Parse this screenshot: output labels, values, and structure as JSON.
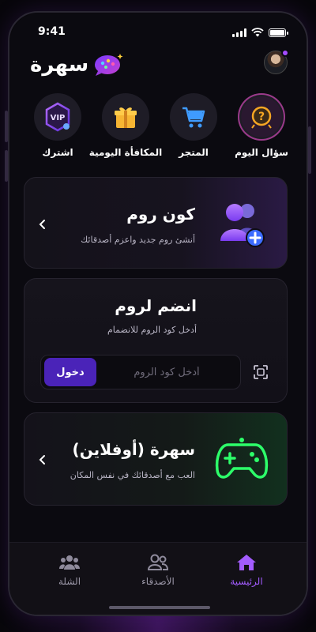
{
  "status": {
    "time": "9:41"
  },
  "header": {
    "app_name": "سهرة"
  },
  "quick_actions": [
    {
      "label": "اشترك",
      "icon": "vip-badge-icon",
      "badge": "VIP"
    },
    {
      "label": "المكافأة اليومية",
      "icon": "gift-icon"
    },
    {
      "label": "المتجر",
      "icon": "cart-icon"
    },
    {
      "label": "سؤال اليوم",
      "icon": "question-icon"
    }
  ],
  "create_room": {
    "title": "كون روم",
    "subtitle": "أنشئ روم جديد واعزم أصدقائك"
  },
  "join_room": {
    "title": "انضم لروم",
    "subtitle": "أدخل كود الروم للانضمام",
    "placeholder": "أدخل كود الروم",
    "button": "دخول"
  },
  "offline": {
    "title": "سهرة (أوفلاين)",
    "subtitle": "العب مع أصدقائك في نفس المكان"
  },
  "tabbar": {
    "items": [
      {
        "label": "الشلة",
        "icon": "group-icon"
      },
      {
        "label": "الأصدقاء",
        "icon": "friends-icon"
      },
      {
        "label": "الرئيسية",
        "icon": "home-icon",
        "active": true
      }
    ]
  },
  "colors": {
    "accent": "#a35cff",
    "button": "#4a23b8",
    "offline_accent": "#2dff6a"
  }
}
